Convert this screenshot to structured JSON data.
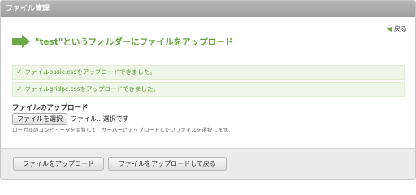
{
  "window": {
    "title": "ファイル管理"
  },
  "nav": {
    "back_label": "戻る"
  },
  "heading": {
    "text": "\"test\"というフォルダーにファイルをアップロード"
  },
  "messages": [
    "ファイルbasic.cssをアップロードできました。",
    "ファイルgridpc.cssをアップロードできました。"
  ],
  "upload": {
    "label": "ファイルのアップロード",
    "choose_button": "ファイルを選択",
    "status": "ファイル...選択です",
    "help": "ローカルのコンピュータを閲覧して、サーバーにアップロードしたいファイルを選択します。"
  },
  "footer": {
    "upload_button": "ファイルをアップロード",
    "upload_back_button": "ファイルをアップロードして戻る"
  },
  "colors": {
    "accent": "#5fa238",
    "message_bg": "#eef6e7",
    "titlebar": "#aaaaaa"
  },
  "icons": {
    "heading": "arrow-right-icon",
    "back": "arrow-left-icon",
    "message": "check-icon"
  }
}
